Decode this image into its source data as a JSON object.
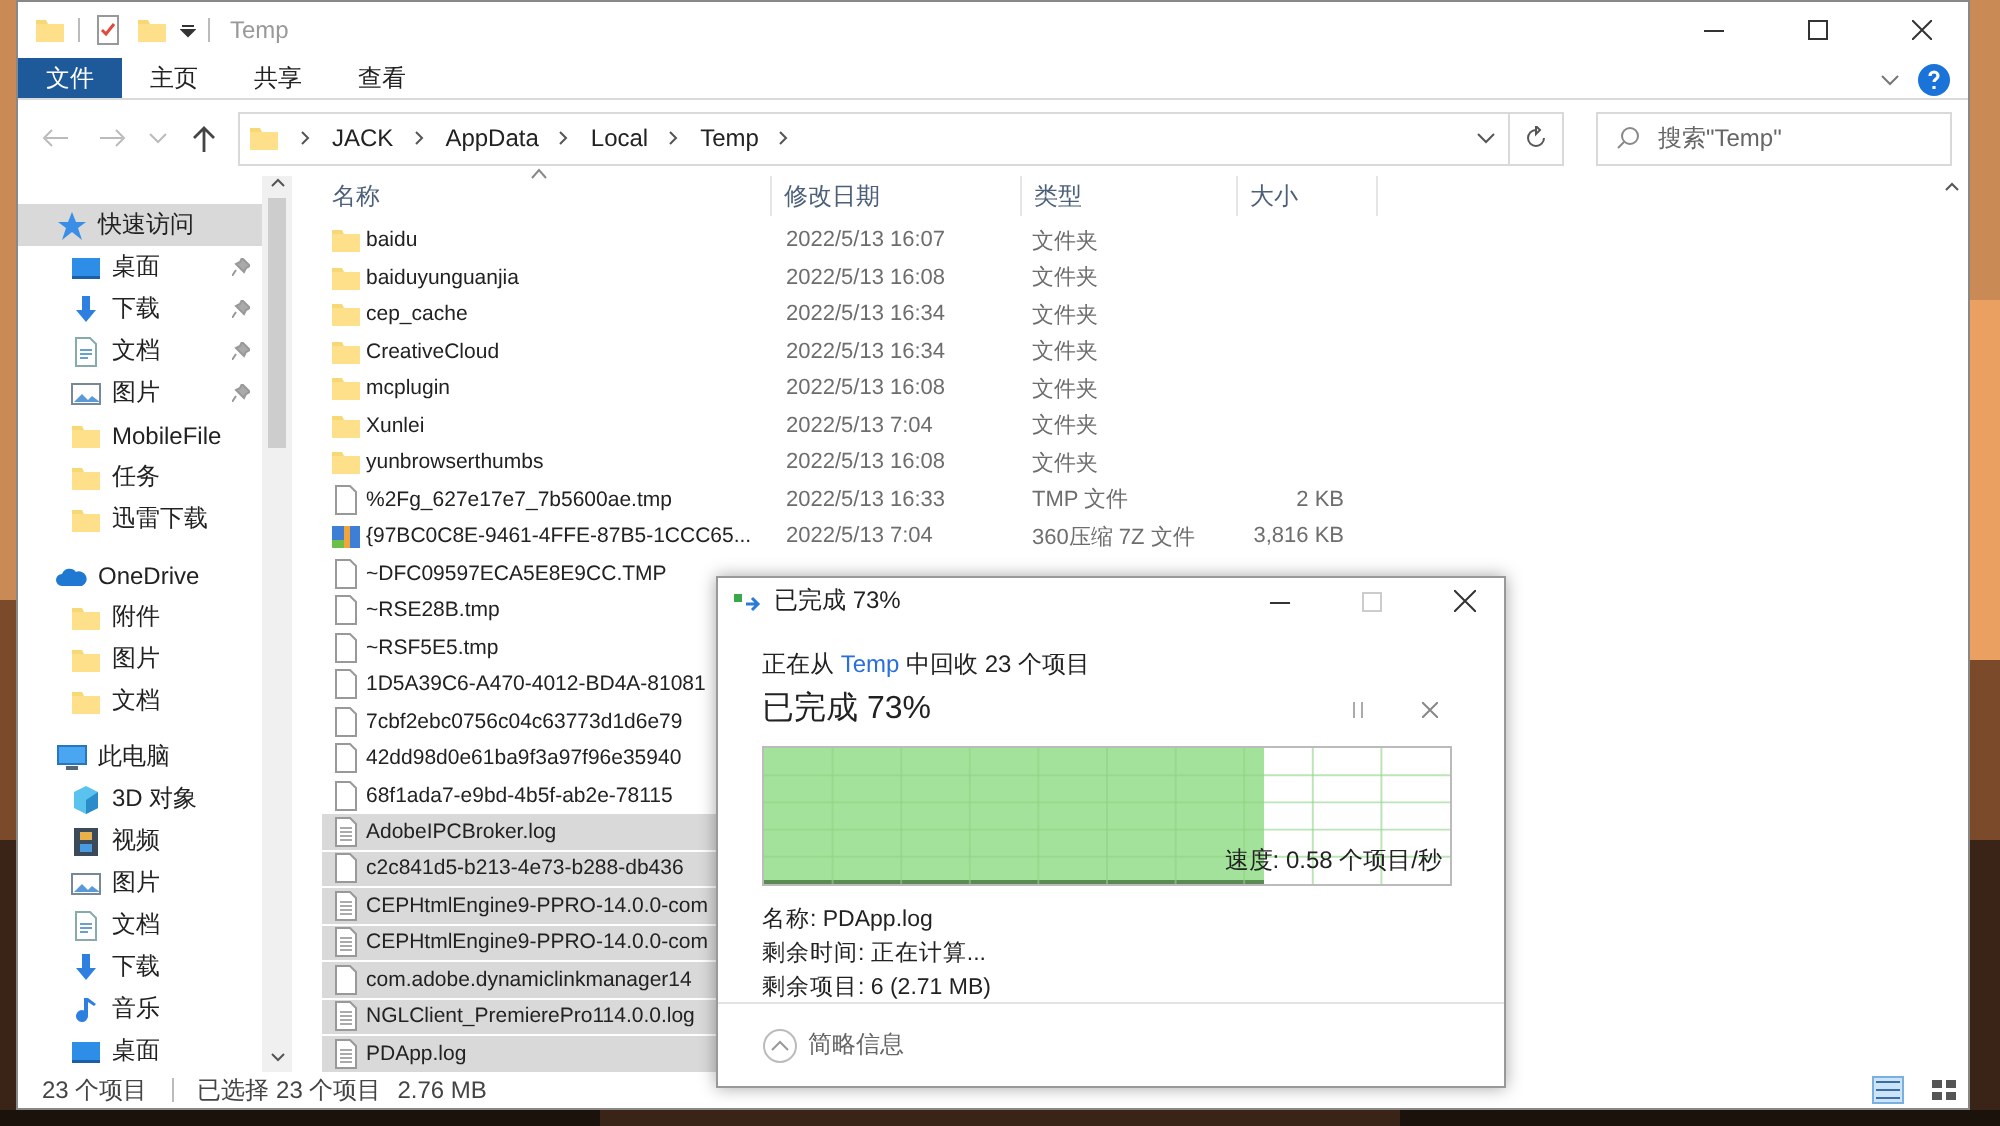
{
  "window": {
    "title": "Temp"
  },
  "ribbon_tabs": [
    {
      "label": "文件",
      "kind": "file"
    },
    {
      "label": "主页",
      "kind": "tab"
    },
    {
      "label": "共享",
      "kind": "tab"
    },
    {
      "label": "查看",
      "kind": "tab"
    }
  ],
  "address": {
    "crumbs": [
      "JACK",
      "AppData",
      "Local",
      "Temp"
    ]
  },
  "search": {
    "placeholder": "搜索\"Temp\""
  },
  "nav": [
    {
      "label": "快速访问",
      "kind": "star",
      "selected": true,
      "children": [
        {
          "label": "桌面",
          "kind": "desktop",
          "pinned": true
        },
        {
          "label": "下载",
          "kind": "download",
          "pinned": true
        },
        {
          "label": "文档",
          "kind": "document",
          "pinned": true
        },
        {
          "label": "图片",
          "kind": "pictures",
          "pinned": true
        },
        {
          "label": "MobileFile",
          "kind": "folder",
          "pinned": false
        },
        {
          "label": "任务",
          "kind": "folder",
          "pinned": false
        },
        {
          "label": "迅雷下载",
          "kind": "folder",
          "pinned": false
        }
      ]
    },
    {
      "label": "OneDrive",
      "kind": "cloud",
      "selected": false,
      "children": [
        {
          "label": "附件",
          "kind": "folder",
          "pinned": false
        },
        {
          "label": "图片",
          "kind": "folder",
          "pinned": false
        },
        {
          "label": "文档",
          "kind": "folder",
          "pinned": false
        }
      ]
    },
    {
      "label": "此电脑",
      "kind": "computer",
      "selected": false,
      "children": [
        {
          "label": "3D 对象",
          "kind": "cube",
          "pinned": false
        },
        {
          "label": "视频",
          "kind": "video",
          "pinned": false
        },
        {
          "label": "图片",
          "kind": "pictures",
          "pinned": false
        },
        {
          "label": "文档",
          "kind": "document",
          "pinned": false
        },
        {
          "label": "下载",
          "kind": "download",
          "pinned": false
        },
        {
          "label": "音乐",
          "kind": "music",
          "pinned": false
        },
        {
          "label": "桌面",
          "kind": "desktop",
          "pinned": false
        }
      ]
    }
  ],
  "columns": [
    {
      "label": "名称",
      "sorted": true
    },
    {
      "label": "修改日期",
      "sorted": false
    },
    {
      "label": "类型",
      "sorted": false
    },
    {
      "label": "大小",
      "sorted": false
    }
  ],
  "rows": [
    {
      "name": "baidu",
      "kind": "folder",
      "date": "2022/5/13 16:07",
      "type": "文件夹",
      "selected": false
    },
    {
      "name": "baiduyunguanjia",
      "kind": "folder",
      "date": "2022/5/13 16:08",
      "type": "文件夹",
      "selected": false
    },
    {
      "name": "cep_cache",
      "kind": "folder",
      "date": "2022/5/13 16:34",
      "type": "文件夹",
      "selected": false
    },
    {
      "name": "CreativeCloud",
      "kind": "folder",
      "date": "2022/5/13 16:34",
      "type": "文件夹",
      "selected": false
    },
    {
      "name": "mcplugin",
      "kind": "folder",
      "date": "2022/5/13 16:08",
      "type": "文件夹",
      "selected": false
    },
    {
      "name": "Xunlei",
      "kind": "folder",
      "date": "2022/5/13 7:04",
      "type": "文件夹",
      "selected": false
    },
    {
      "name": "yunbrowserthumbs",
      "kind": "folder",
      "date": "2022/5/13 16:08",
      "type": "文件夹",
      "selected": false
    },
    {
      "name": "%2Fg_627e17e7_7b5600ae.tmp",
      "kind": "file",
      "date": "2022/5/13 16:33",
      "type": "TMP 文件",
      "size": "2 KB",
      "selected": false
    },
    {
      "name": "{97BC0C8E-9461-4FFE-87B5-1CCC65...",
      "kind": "archive",
      "date": "2022/5/13 7:04",
      "type": "360压缩 7Z 文件",
      "size": "3,816 KB",
      "selected": false
    },
    {
      "name": "~DFC09597ECA5E8E9CC.TMP",
      "kind": "file",
      "selected": false
    },
    {
      "name": "~RSE28B.tmp",
      "kind": "file",
      "selected": false
    },
    {
      "name": "~RSF5E5.tmp",
      "kind": "file",
      "selected": false
    },
    {
      "name": "1D5A39C6-A470-4012-BD4A-81081",
      "kind": "file",
      "selected": false
    },
    {
      "name": "7cbf2ebc0756c04c63773d1d6e79",
      "kind": "file",
      "selected": false
    },
    {
      "name": "42dd98d0e61ba9f3a97f96e35940",
      "kind": "file",
      "selected": false
    },
    {
      "name": "68f1ada7-e9bd-4b5f-ab2e-78115",
      "kind": "file",
      "selected": false
    },
    {
      "name": "AdobeIPCBroker.log",
      "kind": "log",
      "selected": true
    },
    {
      "name": "c2c841d5-b213-4e73-b288-db436",
      "kind": "file",
      "selected": true
    },
    {
      "name": "CEPHtmlEngine9-PPRO-14.0.0-com",
      "kind": "log",
      "selected": true
    },
    {
      "name": "CEPHtmlEngine9-PPRO-14.0.0-com",
      "kind": "log",
      "selected": true
    },
    {
      "name": "com.adobe.dynamiclinkmanager14",
      "kind": "file",
      "selected": true
    },
    {
      "name": "NGLClient_PremierePro114.0.0.log",
      "kind": "log",
      "selected": true
    },
    {
      "name": "PDApp.log",
      "kind": "log",
      "selected": true
    }
  ],
  "status_bar": {
    "count": "23 个项目",
    "selection": "已选择 23 个项目",
    "size": "2.76 MB"
  },
  "dialog": {
    "title": "已完成 73%",
    "source_prefix": "正在从 ",
    "source_link": "Temp",
    "source_suffix": " 中回收 23 个项目",
    "heading": "已完成 73%",
    "level": 0.73,
    "speed": "速度: 0.58 个项目/秒",
    "details": [
      "名称: PDApp.log",
      "剩余时间: 正在计算...",
      "剩余项目: 6 (2.71 MB)"
    ],
    "footer": "简略信息"
  }
}
